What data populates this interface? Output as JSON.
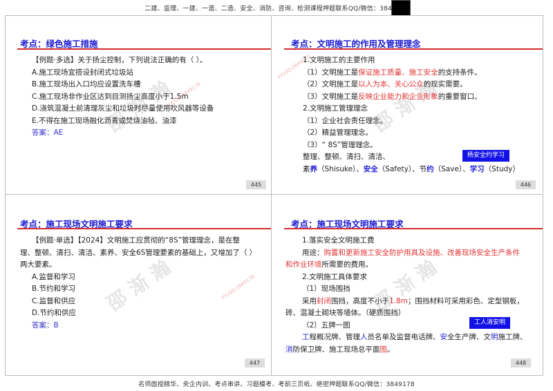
{
  "header_banner": "二建、监理、一建、一造、二造、安全、消防、咨询、检测课程押题联系QQ/微信：3849178",
  "footer_banner": "名师面授精华、央企内训、考点串讲、习题模考、考前三页纸、绝密押题联系QQ/微信：3849178",
  "watermark": "VX/QQ:3849178",
  "watermark_logo": "邵 渐 瀚",
  "slides": [
    {
      "heading": "考点：绿色施工措施",
      "page": "445",
      "lines": [
        [
          {
            "t": "【例题·多选】关于扬尘控制，下列说法正确的有（ ）。"
          }
        ],
        [
          {
            "t": "A.施工现场宜搭设封闭式垃圾站"
          }
        ],
        [
          {
            "t": "B.施工现场出入口均应设置洗车槽"
          }
        ],
        [
          {
            "t": "C.施工现场非作业区达到目测扬尘高度小于1.5m"
          }
        ],
        [
          {
            "t": "D.浇筑混凝土前清理灰尘和垃圾时尽量使用吹风器等设备"
          }
        ],
        [
          {
            "t": "E.不得在施工现场融化沥青或焚烧油毡、油漆"
          }
        ],
        [
          {
            "t": "答案：AE",
            "c": "ans"
          }
        ]
      ]
    },
    {
      "heading": "考点：文明施工的作用及管理理念",
      "page": "446",
      "tag_button": "杨安全约学习",
      "lines": [
        [
          {
            "t": "1.文明施工的主要作用"
          }
        ],
        [
          {
            "t": "（1）文明施工是"
          },
          {
            "t": "保证施工质量、施工安全",
            "c": "red"
          },
          {
            "t": "的支持条件。"
          }
        ],
        [
          {
            "t": "（2）文明施工是"
          },
          {
            "t": "以人为本、关心公众",
            "c": "red"
          },
          {
            "t": "的现实需要。"
          }
        ],
        [
          {
            "t": "（3）文明施工是"
          },
          {
            "t": "反映企业能力和企业形象",
            "c": "red"
          },
          {
            "t": "的重要窗口。"
          }
        ],
        [
          {
            "t": "2.文明施工管理理念"
          }
        ],
        [
          {
            "t": "（1）企业社会责任理念。"
          }
        ],
        [
          {
            "t": "（2）精益管理理念。"
          }
        ],
        [
          {
            "t": "（3）“ 8S”管理理念。"
          }
        ],
        [
          {
            "t": "整理、整顿、清扫、清洁、"
          }
        ],
        [
          {
            "t": "素"
          },
          {
            "t": "养",
            "c": "blue bold"
          },
          {
            "t": "（Shisuke）、"
          },
          {
            "t": "安全",
            "c": "blue bold"
          },
          {
            "t": "（Safety）、节"
          },
          {
            "t": "约",
            "c": "blue bold"
          },
          {
            "t": "（Save）、"
          },
          {
            "t": "学习",
            "c": "blue bold"
          },
          {
            "t": "（Study）"
          }
        ]
      ]
    },
    {
      "heading": "考点：施工现场文明施工要求",
      "page": "447",
      "lines": [
        [
          {
            "t": "【例题·单选】【2024】文明施工应贯彻的“8S”管理理念，是在整"
          }
        ],
        [
          {
            "t": "理、整顿、清扫、清洁、素养、安全6S管理要素的基础上，又增加了（ ）"
          }
        ],
        [
          {
            "t": "两大要素。"
          }
        ],
        [
          {
            "t": "A.监督和学习"
          }
        ],
        [
          {
            "t": "B.节约和学习"
          }
        ],
        [
          {
            "t": "C.监督和供应"
          }
        ],
        [
          {
            "t": "D.节约和供应"
          }
        ],
        [
          {
            "t": "答案：B",
            "c": "ans"
          }
        ]
      ]
    },
    {
      "heading": "考点：施工现场文明施工要求",
      "page": "448",
      "tag_button": "工人消安明",
      "lines": [
        [
          {
            "t": "1.落实安全文明施工费"
          }
        ],
        [
          {
            "t": "用途："
          },
          {
            "t": "购置和更新施工安全防护用具及设施、改善现场安全生产条件",
            "c": "red"
          }
        ],
        [
          {
            "t": "和作业环境",
            "c": "red"
          },
          {
            "t": "所需要的费用。"
          }
        ],
        [
          {
            "t": "2.文明施工具体要求"
          }
        ],
        [
          {
            "t": "（1）现场围挡"
          }
        ],
        [
          {
            "t": "采用"
          },
          {
            "t": "封闭",
            "c": "red"
          },
          {
            "t": "围挡，高度不小于"
          },
          {
            "t": "1.8m",
            "c": "red"
          },
          {
            "t": "；围挡材料可采用彩色、定型钢板，"
          }
        ],
        [
          {
            "t": "砖、混凝土砌块等墙体。（硬质围挡）"
          }
        ],
        [
          {
            "t": "（2）五牌一图"
          }
        ],
        [
          {
            "t": "工",
            "c": "blue"
          },
          {
            "t": "程概况牌、管理"
          },
          {
            "t": "人",
            "c": "blue"
          },
          {
            "t": "员名单及监督电话牌、"
          },
          {
            "t": "安",
            "c": "blue"
          },
          {
            "t": "全生产牌、文"
          },
          {
            "t": "明",
            "c": "blue"
          },
          {
            "t": "施工牌、"
          }
        ],
        [
          {
            "t": "消",
            "c": "blue"
          },
          {
            "t": "防保卫牌、施工现场总平面"
          },
          {
            "t": "图",
            "c": "red"
          },
          {
            "t": "。"
          }
        ]
      ]
    }
  ]
}
